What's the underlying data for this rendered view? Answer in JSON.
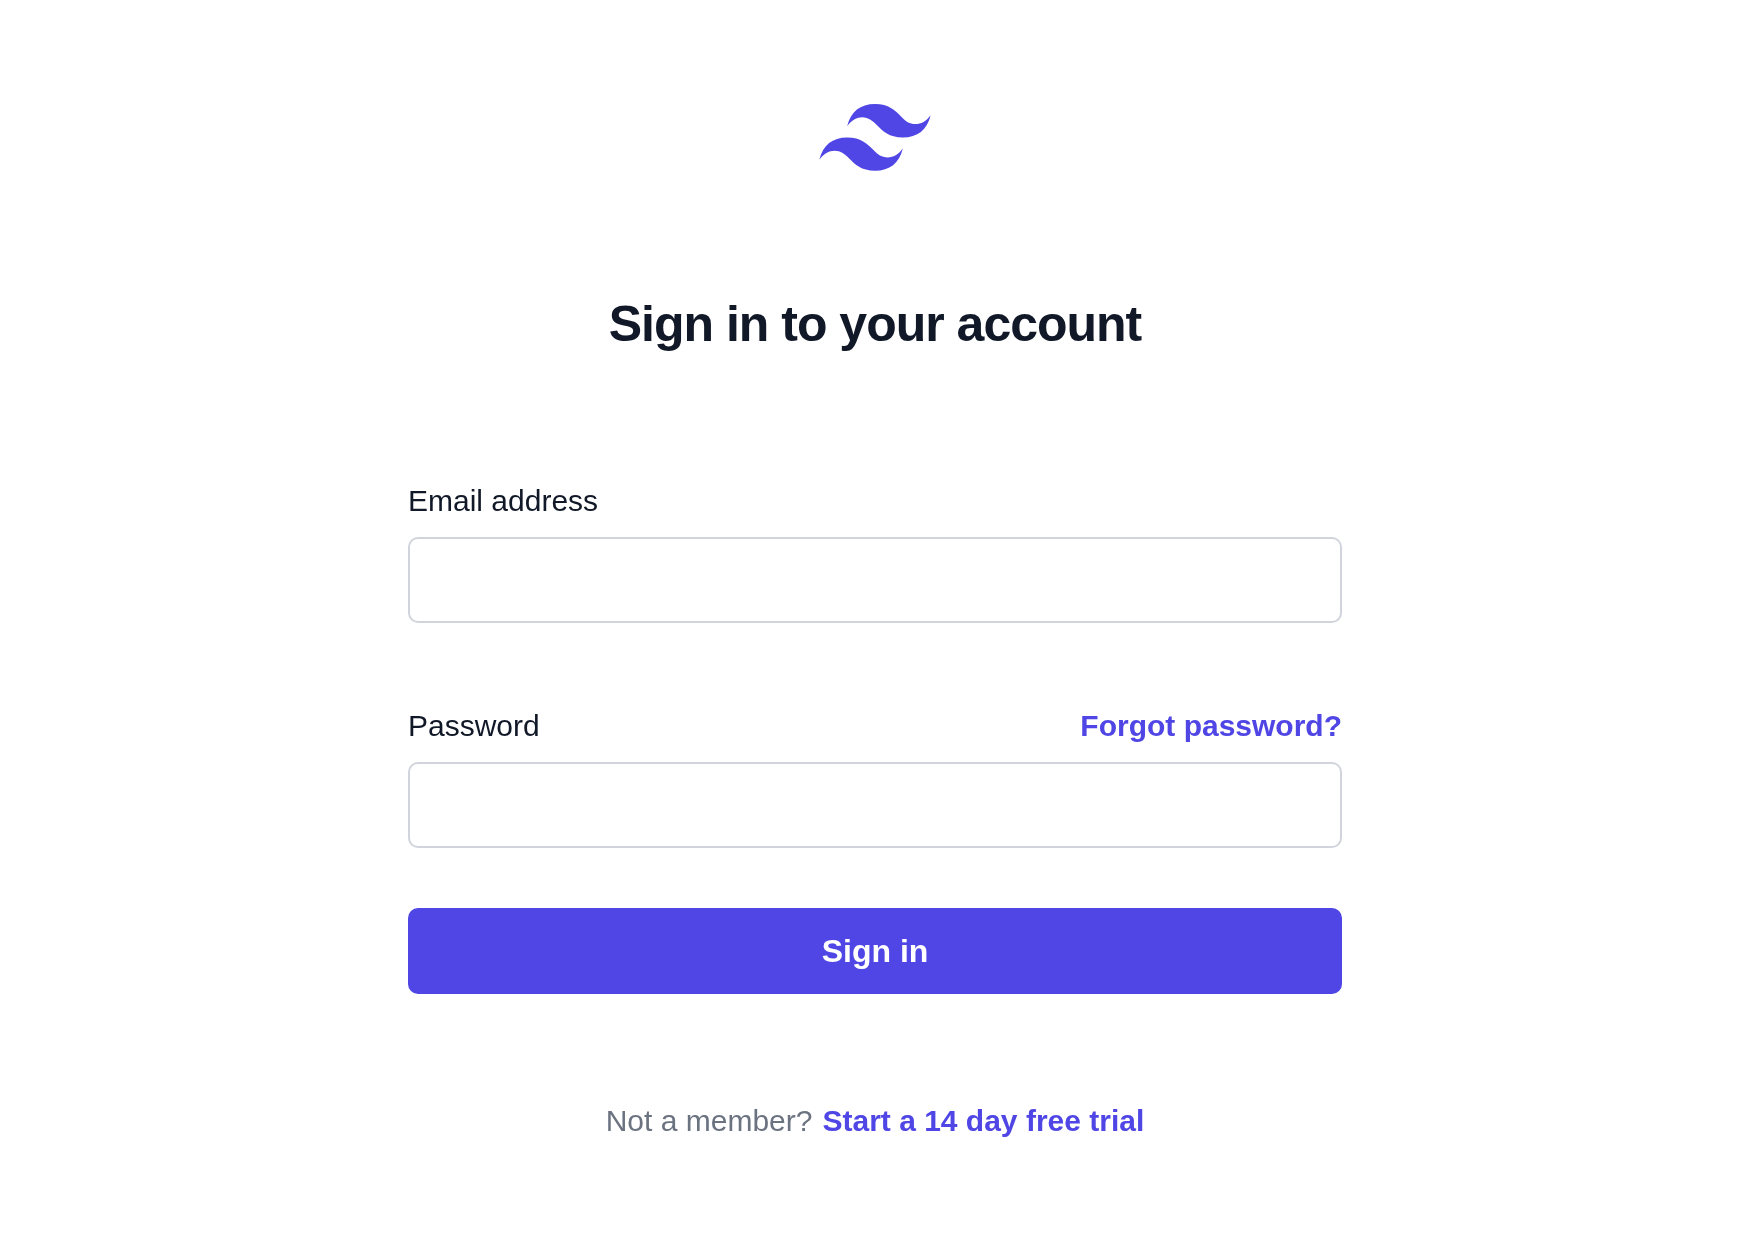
{
  "heading": "Sign in to your account",
  "fields": [
    {
      "label": "Email address"
    },
    {
      "label": "Password",
      "link": "Forgot password?"
    }
  ],
  "submit": "Sign in",
  "footer": {
    "text": "Not a member?",
    "link": "Start a 14 day free trial"
  }
}
